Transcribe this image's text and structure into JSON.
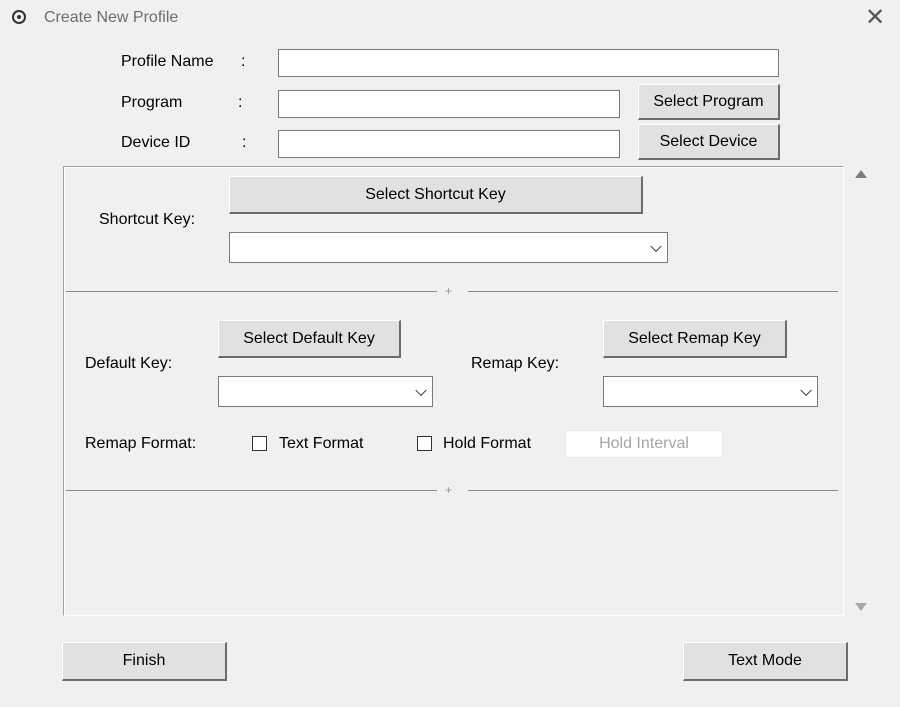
{
  "window": {
    "title": "Create New Profile",
    "close_glyph": "✕"
  },
  "form": {
    "profile_name_label": "Profile Name",
    "program_label": "Program",
    "device_id_label": "Device ID",
    "colon": ":",
    "profile_name_value": "",
    "program_value": "",
    "device_id_value": "",
    "select_program_button": "Select Program",
    "select_device_button": "Select Device"
  },
  "shortcut": {
    "label": "Shortcut Key:",
    "select_button": "Select Shortcut Key",
    "selected_value": ""
  },
  "divider_glyph": "+",
  "remap": {
    "default_key_label": "Default Key:",
    "select_default_button": "Select Default Key",
    "default_value": "",
    "remap_key_label": "Remap Key:",
    "select_remap_button": "Select Remap Key",
    "remap_value": "",
    "format_label": "Remap Format:",
    "text_format_label": "Text Format",
    "text_format_checked": false,
    "hold_format_label": "Hold Format",
    "hold_format_checked": false,
    "hold_interval_placeholder": "Hold Interval"
  },
  "footer": {
    "finish_button": "Finish",
    "text_mode_button": "Text Mode"
  },
  "icons": {
    "app": "target-icon",
    "close": "close-icon",
    "scroll_up": "scroll-up-arrow-icon",
    "scroll_down": "scroll-down-arrow-icon",
    "dropdown": "chevron-down-icon"
  }
}
